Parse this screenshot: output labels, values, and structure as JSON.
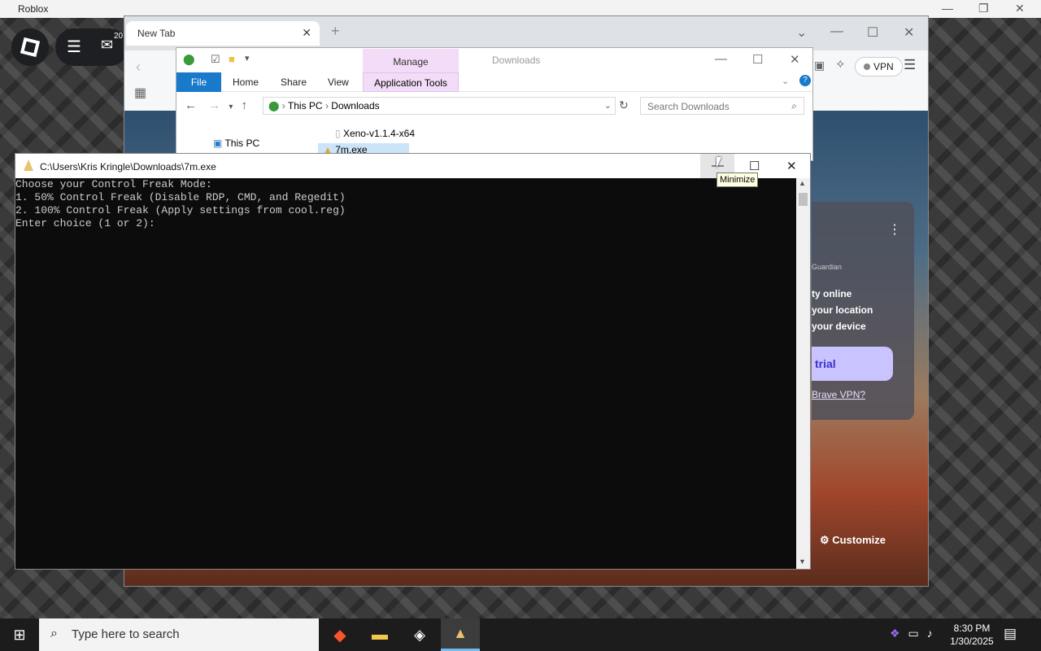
{
  "roblox": {
    "title": "Roblox",
    "badge": "20"
  },
  "browser": {
    "tab_title": "New Tab",
    "vpn_label": "VPN"
  },
  "vpn_card": {
    "line1": "Guardian",
    "line2": "ty online",
    "line3": "your location",
    "line4": "your device",
    "trial": "trial",
    "link": "Brave VPN?"
  },
  "customize": "Customize",
  "explorer": {
    "manage": "Manage",
    "title": "Downloads",
    "tabs": [
      "File",
      "Home",
      "Share",
      "View",
      "Application Tools"
    ],
    "path": [
      "This PC",
      "Downloads"
    ],
    "search_placeholder": "Search Downloads",
    "nav_item": "This PC",
    "files": [
      "Xeno-v1.1.4-x64",
      "7m.exe"
    ]
  },
  "console": {
    "title": "C:\\Users\\Kris Kringle\\Downloads\\7m.exe",
    "lines": [
      "Choose your Control Freak Mode:",
      "1. 50% Control Freak (Disable RDP, CMD, and Regedit)",
      "2. 100% Control Freak (Apply settings from cool.reg)",
      "Enter choice (1 or 2):"
    ]
  },
  "tooltip": "Minimize",
  "taskbar": {
    "search_placeholder": "Type here to search",
    "time": "8:30 PM",
    "date": "1/30/2025"
  }
}
